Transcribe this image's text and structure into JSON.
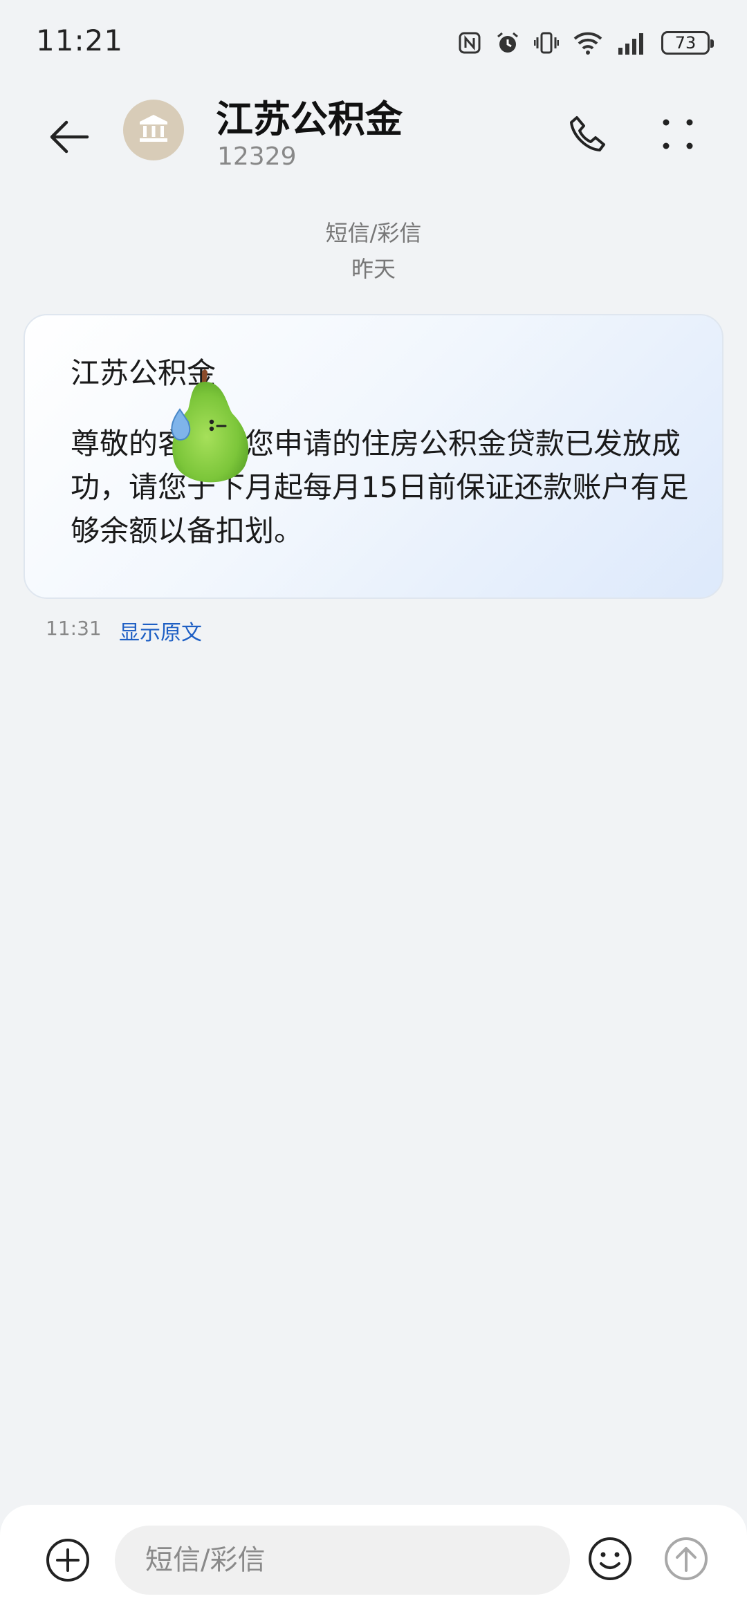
{
  "status_bar": {
    "time": "11:21",
    "battery": "73",
    "icons": [
      "nfc-icon",
      "alarm-icon",
      "vibrate-icon",
      "wifi-icon",
      "signal-icon",
      "battery-icon"
    ]
  },
  "header": {
    "contact_name": "江苏公积金",
    "contact_number": "12329",
    "avatar_icon": "bank-icon",
    "back_icon": "back-arrow-icon",
    "call_icon": "phone-icon",
    "more_icon": "more-icon"
  },
  "thread": {
    "channel_label": "短信/彩信",
    "date_label": "昨天"
  },
  "message": {
    "title": "江苏公积金",
    "body": "尊敬的客户，您申请的住房公积金贷款已发放成功，请您于下月起每月15日前保证还款账户有足够余额以备扣划。",
    "time": "11:31",
    "show_original_label": "显示原文",
    "sticker": "pear-sticker"
  },
  "composer": {
    "placeholder": "短信/彩信",
    "value": "",
    "plus_icon": "add-circle-icon",
    "emoji_icon": "emoji-icon",
    "send_icon": "send-arrow-icon"
  },
  "colors": {
    "background": "#f1f3f5",
    "link": "#1e5fc4",
    "avatar": "#d8ccb8"
  }
}
